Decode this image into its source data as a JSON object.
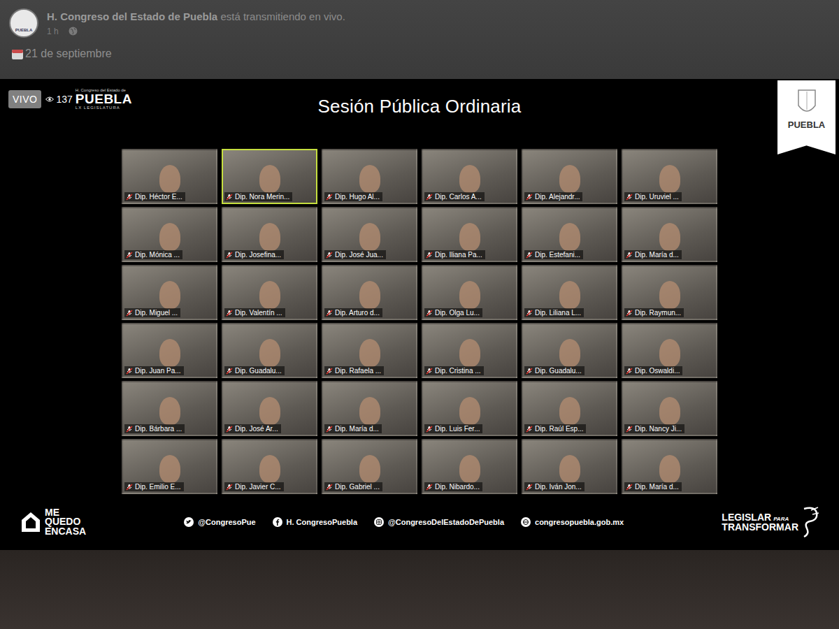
{
  "post": {
    "page_name": "H. Congreso del Estado de Puebla",
    "action": "está transmitiendo en vivo.",
    "time": "1 h",
    "date": "21 de septiembre",
    "avatar_text": "PUEBLA"
  },
  "stream": {
    "live_badge": "VIVO",
    "viewers": "137",
    "logo": {
      "small": "H. Congreso del Estado de",
      "name": "PUEBLA",
      "sub": "LX LEGISLATURA"
    },
    "corner_logo": "PUEBLA",
    "title": "Sesión Pública Ordinaria"
  },
  "participants": [
    {
      "name": "Dip. Héctor E...",
      "speaking": false,
      "muted": true
    },
    {
      "name": "Dip. Nora Merin...",
      "speaking": true,
      "muted": true
    },
    {
      "name": "Dip. Hugo Al...",
      "speaking": false,
      "muted": true
    },
    {
      "name": "Dip. Carlos A...",
      "speaking": false,
      "muted": true
    },
    {
      "name": "Dip. Alejandr...",
      "speaking": false,
      "muted": true
    },
    {
      "name": "Dip. Uruviel ...",
      "speaking": false,
      "muted": true
    },
    {
      "name": "Dip. Mónica ...",
      "speaking": false,
      "muted": true
    },
    {
      "name": "Dip. Josefina...",
      "speaking": false,
      "muted": true
    },
    {
      "name": "Dip. José Jua...",
      "speaking": false,
      "muted": true
    },
    {
      "name": "Dip. Iliana Pa...",
      "speaking": false,
      "muted": true
    },
    {
      "name": "Dip. Estefani...",
      "speaking": false,
      "muted": true
    },
    {
      "name": "Dip. María d...",
      "speaking": false,
      "muted": true
    },
    {
      "name": "Dip. Miguel ...",
      "speaking": false,
      "muted": true
    },
    {
      "name": "Dip. Valentín ...",
      "speaking": false,
      "muted": true
    },
    {
      "name": "Dip. Arturo d...",
      "speaking": false,
      "muted": true
    },
    {
      "name": "Dip. Olga Lu...",
      "speaking": false,
      "muted": true
    },
    {
      "name": "Dip. Liliana L...",
      "speaking": false,
      "muted": true
    },
    {
      "name": "Dip. Raymun...",
      "speaking": false,
      "muted": true
    },
    {
      "name": "Dip. Juan Pa...",
      "speaking": false,
      "muted": true
    },
    {
      "name": "Dip. Guadalu...",
      "speaking": false,
      "muted": true
    },
    {
      "name": "Dip. Rafaela ...",
      "speaking": false,
      "muted": true
    },
    {
      "name": "Dip. Cristina ...",
      "speaking": false,
      "muted": true
    },
    {
      "name": "Dip. Guadalu...",
      "speaking": false,
      "muted": true
    },
    {
      "name": "Dip. Oswaldi...",
      "speaking": false,
      "muted": true
    },
    {
      "name": "Dip. Bárbara ...",
      "speaking": false,
      "muted": true
    },
    {
      "name": "Dip. José Ar...",
      "speaking": false,
      "muted": true
    },
    {
      "name": "Dip. María d...",
      "speaking": false,
      "muted": true
    },
    {
      "name": "Dip. Luis Fer...",
      "speaking": false,
      "muted": true
    },
    {
      "name": "Dip. Raúl Esp...",
      "speaking": false,
      "muted": true
    },
    {
      "name": "Dip. Nancy Ji...",
      "speaking": false,
      "muted": true
    },
    {
      "name": "Dip. Emilio E...",
      "speaking": false,
      "muted": true
    },
    {
      "name": "Dip. Javier C...",
      "speaking": false,
      "muted": true
    },
    {
      "name": "Dip. Gabriel ...",
      "speaking": false,
      "muted": true
    },
    {
      "name": "Dip. Nibardo...",
      "speaking": false,
      "muted": true
    },
    {
      "name": "Dip. Iván Jon...",
      "speaking": false,
      "muted": true
    },
    {
      "name": "Dip. María d...",
      "speaking": false,
      "muted": true
    }
  ],
  "footer": {
    "campaign": [
      "ME",
      "QUEDO",
      "ENCASA"
    ],
    "socials": [
      {
        "kind": "twitter",
        "label": "@CongresoPue"
      },
      {
        "kind": "facebook",
        "label": "H. CongresoPuebla"
      },
      {
        "kind": "instagram",
        "label": "@CongresoDelEstadoDePuebla"
      },
      {
        "kind": "web",
        "label": "congresopuebla.gob.mx"
      }
    ],
    "slogan": {
      "main": "LEGISLAR",
      "small": "PARA",
      "last": "TRANSFORMAR"
    }
  }
}
